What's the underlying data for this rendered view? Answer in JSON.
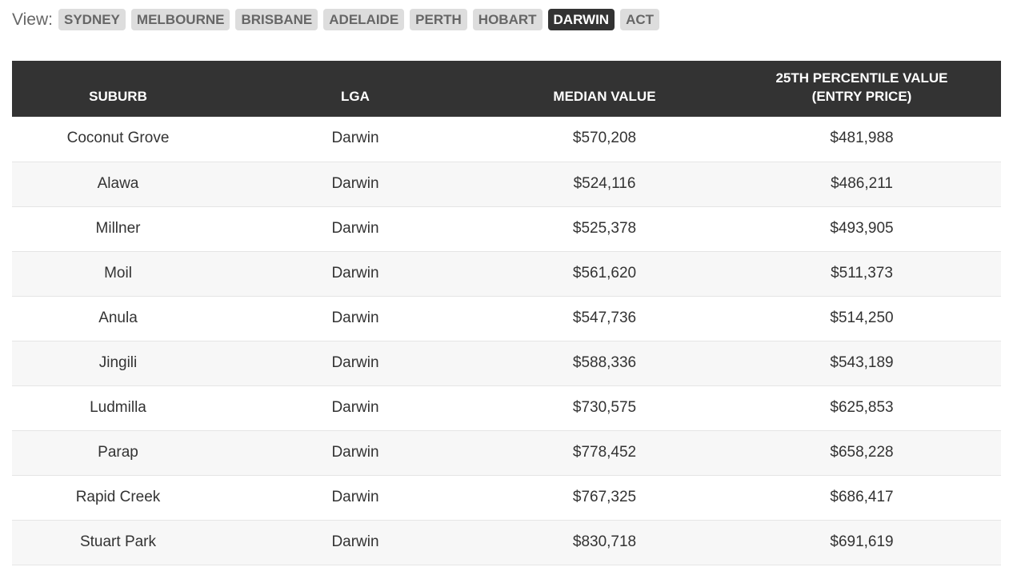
{
  "view": {
    "label": "View:",
    "cities": [
      {
        "label": "SYDNEY",
        "active": false
      },
      {
        "label": "MELBOURNE",
        "active": false
      },
      {
        "label": "BRISBANE",
        "active": false
      },
      {
        "label": "ADELAIDE",
        "active": false
      },
      {
        "label": "PERTH",
        "active": false
      },
      {
        "label": "HOBART",
        "active": false
      },
      {
        "label": "DARWIN",
        "active": true
      },
      {
        "label": "ACT",
        "active": false
      }
    ]
  },
  "table": {
    "headers": {
      "suburb": "SUBURB",
      "lga": "LGA",
      "median": "MEDIAN VALUE",
      "percentile_line1": "25TH PERCENTILE VALUE",
      "percentile_line2": "(ENTRY PRICE)"
    },
    "rows": [
      {
        "suburb": "Coconut Grove",
        "lga": "Darwin",
        "median": "$570,208",
        "p25": "$481,988"
      },
      {
        "suburb": "Alawa",
        "lga": "Darwin",
        "median": "$524,116",
        "p25": "$486,211"
      },
      {
        "suburb": "Millner",
        "lga": "Darwin",
        "median": "$525,378",
        "p25": "$493,905"
      },
      {
        "suburb": "Moil",
        "lga": "Darwin",
        "median": "$561,620",
        "p25": "$511,373"
      },
      {
        "suburb": "Anula",
        "lga": "Darwin",
        "median": "$547,736",
        "p25": "$514,250"
      },
      {
        "suburb": "Jingili",
        "lga": "Darwin",
        "median": "$588,336",
        "p25": "$543,189"
      },
      {
        "suburb": "Ludmilla",
        "lga": "Darwin",
        "median": "$730,575",
        "p25": "$625,853"
      },
      {
        "suburb": "Parap",
        "lga": "Darwin",
        "median": "$778,452",
        "p25": "$658,228"
      },
      {
        "suburb": "Rapid Creek",
        "lga": "Darwin",
        "median": "$767,325",
        "p25": "$686,417"
      },
      {
        "suburb": "Stuart Park",
        "lga": "Darwin",
        "median": "$830,718",
        "p25": "$691,619"
      }
    ]
  }
}
